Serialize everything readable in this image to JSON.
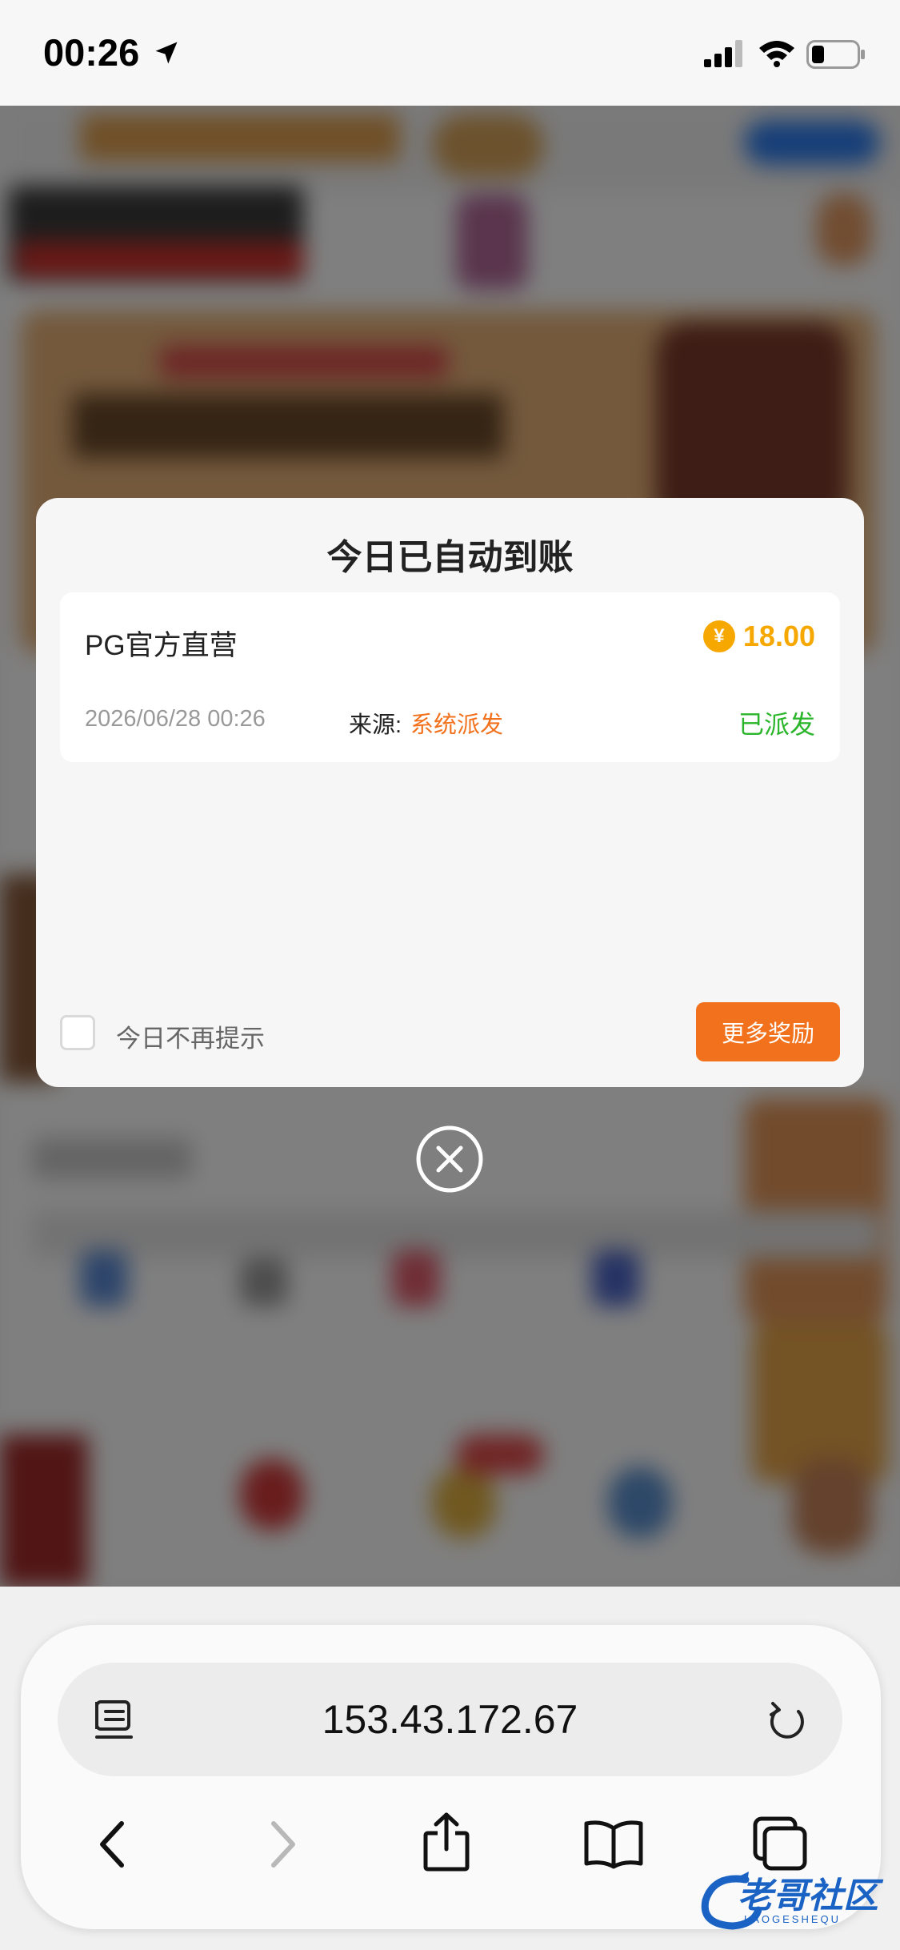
{
  "status_bar": {
    "time": "00:26"
  },
  "modal": {
    "title": "今日已自动到账",
    "reward": {
      "name": "PG官方直营",
      "currency_symbol": "¥",
      "amount": "18.00",
      "date": "2026/06/28 00:26",
      "source_label": "来源:",
      "source_value": "系统派发",
      "status": "已派发"
    },
    "dont_remind_label": "今日不再提示",
    "dont_remind_checked": false,
    "more_button_label": "更多奖励"
  },
  "browser": {
    "url": "153.43.172.67"
  },
  "watermark": {
    "text": "老哥社区",
    "subtext": "LAOGESHEQU"
  },
  "colors": {
    "accent_orange": "#f2711c",
    "coin_gold": "#f6a800",
    "status_green": "#2ab52a"
  }
}
